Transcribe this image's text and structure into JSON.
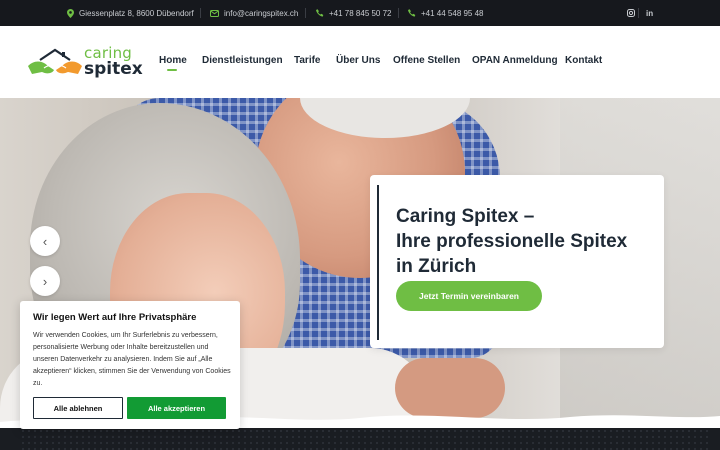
{
  "topbar": {
    "address": "Giessenplatz 8, 8600 Dübendorf",
    "email": "info@caringspitex.ch",
    "phone1": "+41 78 845 50 72",
    "phone2": "+41 44 548 95 48",
    "icons": [
      "map-pin-icon",
      "mail-icon",
      "phone-icon",
      "instagram-icon",
      "linkedin-icon"
    ],
    "social": {
      "instagram": "◎",
      "linkedin": "in"
    }
  },
  "logo": {
    "line1": "caring",
    "line2": "spitex"
  },
  "nav": {
    "items": [
      {
        "label": "Home",
        "active": true
      },
      {
        "label": "Dienstleistungen"
      },
      {
        "label": "Tarife"
      },
      {
        "label": "Über Uns"
      },
      {
        "label": "Offene Stellen"
      },
      {
        "label": "OPAN Anmeldung"
      },
      {
        "label": "Kontakt"
      }
    ]
  },
  "hero": {
    "title": "Caring Spitex –\nIhre professionelle Spitex\nin Zürich",
    "cta": "Jetzt Termin vereinbaren",
    "prev_icon": "‹",
    "next_icon": "›"
  },
  "cookie": {
    "title": "Wir legen Wert auf Ihre Privatsphäre",
    "body": "Wir verwenden Cookies, um Ihr Surferlebnis zu verbessern, personalisierte Werbung oder Inhalte bereitzustellen und unseren Datenverkehr zu analysieren. Indem Sie auf „Alle akzeptieren“ klicken, stimmen Sie der Verwendung von Cookies zu.",
    "reject": "Alle ablehnen",
    "accept": "Alle akzeptieren"
  },
  "colors": {
    "accent": "#6fbe44",
    "dark": "#1f2a36",
    "topbar": "#16181d",
    "accept": "#129b34"
  }
}
